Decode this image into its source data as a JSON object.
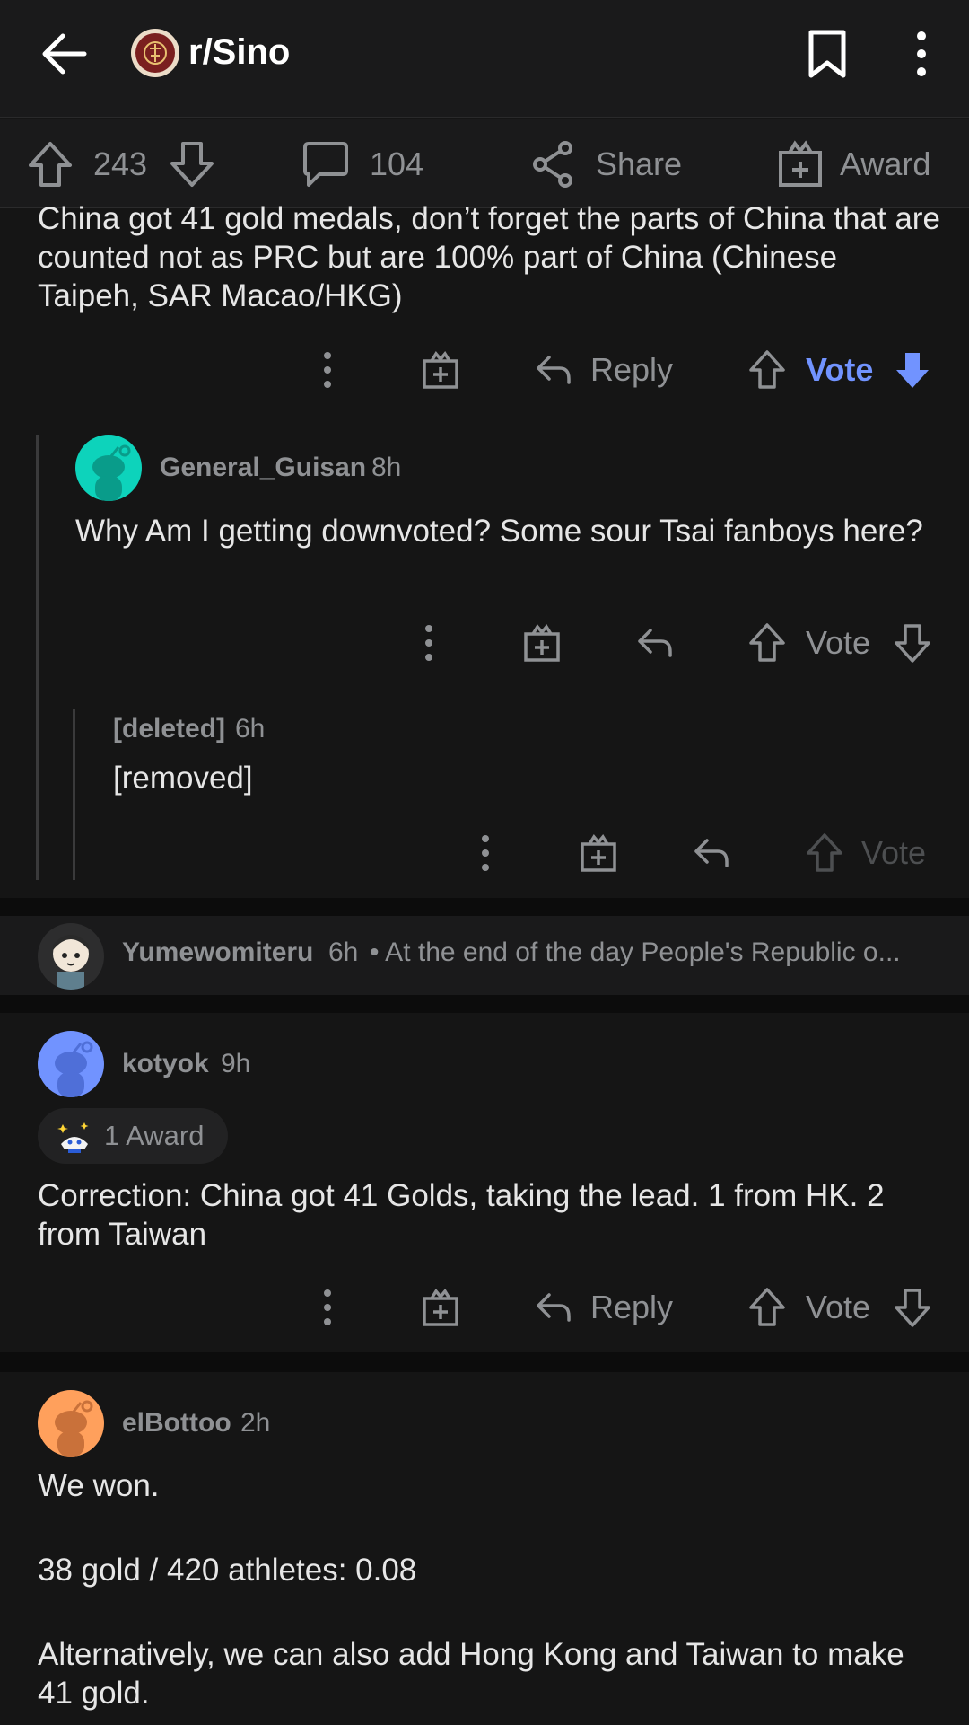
{
  "header": {
    "subreddit": "r/Sino"
  },
  "post_actions": {
    "upvotes": "243",
    "comments": "104",
    "share_label": "Share",
    "award_label": "Award"
  },
  "comments": [
    {
      "text": "China got 41 gold medals, don’t forget the parts of China that are counted not as PRC but are 100% part of China (Chinese Taipeh, SAR Macao/HKG)",
      "reply_label": "Reply",
      "vote_label": "Vote"
    },
    {
      "username": "General_Guisan",
      "time": "8h",
      "text": "Why Am I getting downvoted? Some sour Tsai fanboys here?",
      "vote_label": "Vote"
    },
    {
      "username": "[deleted]",
      "time": "6h",
      "text": "[removed]",
      "vote_label": "Vote"
    },
    {
      "username": "Yumewomiteru",
      "time": "6h",
      "preview": "• At the end of the day People's Republic o..."
    },
    {
      "username": "kotyok",
      "time": "9h",
      "award": "1 Award",
      "text": "Correction: China got 41 Golds, taking the lead. 1 from HK. 2 from Taiwan",
      "reply_label": "Reply",
      "vote_label": "Vote"
    },
    {
      "username": "elBottoo",
      "time": "2h",
      "text_lines": [
        "We won.",
        "38 gold / 420 athletes: 0.08",
        "Alternatively, we can also add Hong Kong and Taiwan to make 41 gold."
      ]
    }
  ],
  "colors": {
    "accent_blue": "#7193ff",
    "background": "#151515",
    "surface": "#1a1a1b",
    "muted_text": "#8f9194"
  }
}
